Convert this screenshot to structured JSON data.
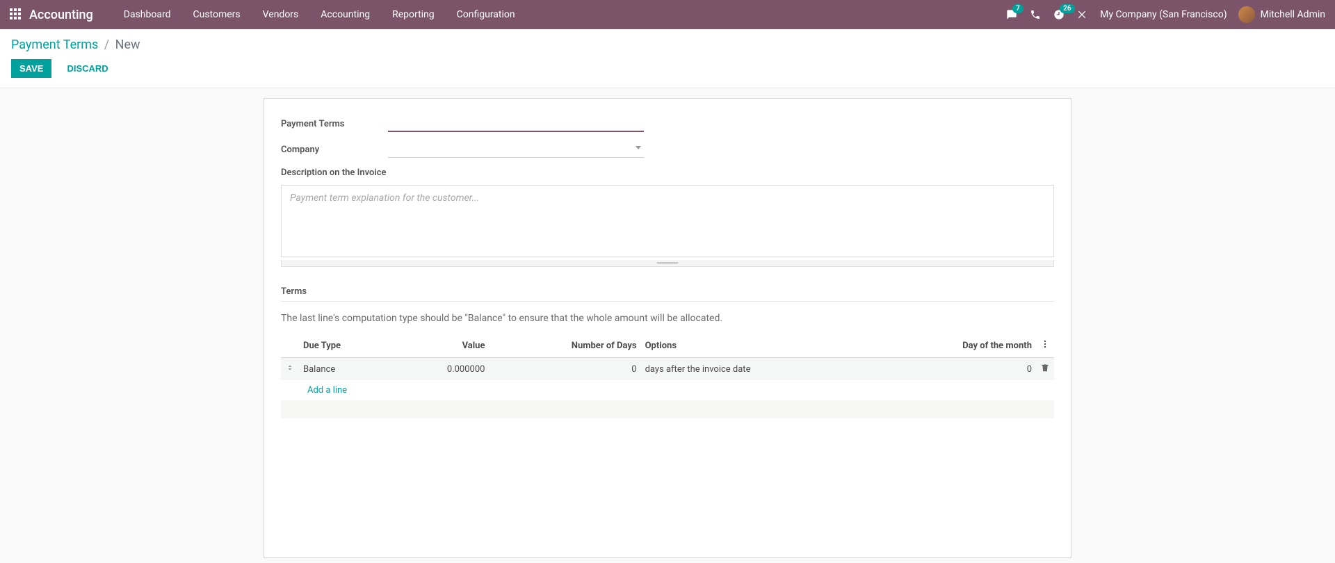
{
  "nav": {
    "brand": "Accounting",
    "links": [
      "Dashboard",
      "Customers",
      "Vendors",
      "Accounting",
      "Reporting",
      "Configuration"
    ],
    "msg_badge": "7",
    "activity_badge": "26",
    "company": "My Company (San Francisco)",
    "user_name": "Mitchell Admin"
  },
  "breadcrumb": {
    "parent": "Payment Terms",
    "current": "New"
  },
  "actions": {
    "save": "SAVE",
    "discard": "DISCARD"
  },
  "form": {
    "fields": {
      "payment_terms_label": "Payment Terms",
      "payment_terms_value": "",
      "company_label": "Company",
      "company_value": "",
      "description_label": "Description on the Invoice",
      "description_placeholder": "Payment term explanation for the customer...",
      "description_value": ""
    },
    "terms": {
      "heading": "Terms",
      "note": "The last line's computation type should be \"Balance\" to ensure that the whole amount will be allocated.",
      "columns": {
        "due_type": "Due Type",
        "value": "Value",
        "days": "Number of Days",
        "options": "Options",
        "dom": "Day of the month"
      },
      "rows": [
        {
          "due_type": "Balance",
          "value": "0.000000",
          "days": "0",
          "options": "days after the invoice date",
          "dom": "0"
        }
      ],
      "add_line": "Add a line"
    }
  }
}
